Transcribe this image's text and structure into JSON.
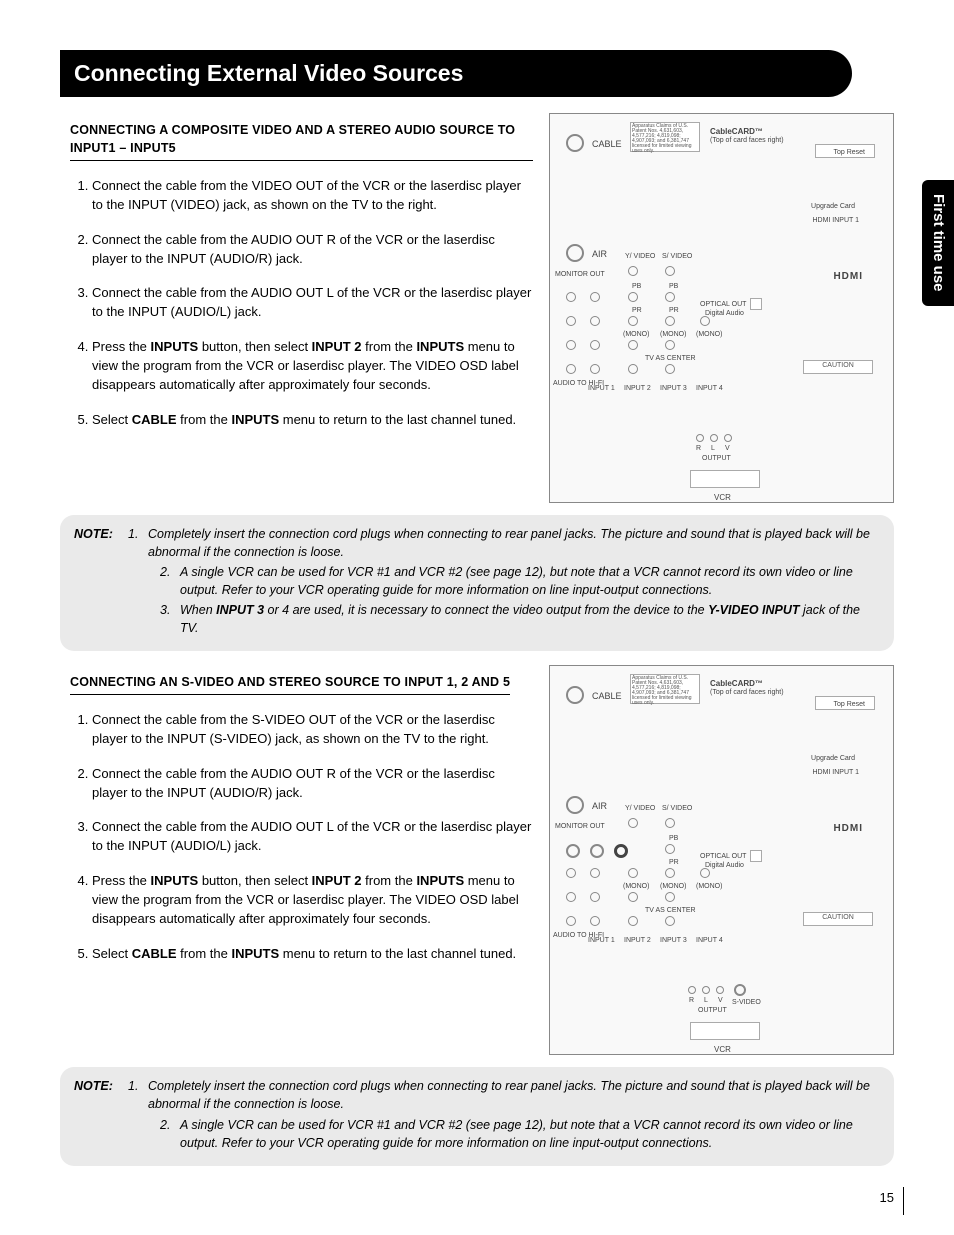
{
  "page_number": "15",
  "side_tab": "First time use",
  "header": "Connecting External Video Sources",
  "section1": {
    "title": "CONNECTING A COMPOSITE VIDEO AND A STEREO AUDIO SOURCE TO INPUT1 – INPUT5",
    "steps": {
      "s1": "Connect the cable from the VIDEO OUT of the VCR or the laserdisc player to the INPUT (VIDEO) jack, as shown on the TV to the right.",
      "s2": "Connect the cable from the AUDIO OUT R of the VCR or the laserdisc player to the INPUT (AUDIO/R) jack.",
      "s3": "Connect the cable from the AUDIO OUT L of the VCR or the laserdisc player to the INPUT (AUDIO/L) jack.",
      "s4_a": "Press the ",
      "s4_inputs1": "INPUTS",
      "s4_b": " button, then select ",
      "s4_input2": "INPUT 2",
      "s4_c": " from the ",
      "s4_inputs2": "INPUTS",
      "s4_d": " menu to view the program from the VCR or laserdisc player. The VIDEO OSD label disappears automatically after approximately four seconds.",
      "s5_a": "Select ",
      "s5_cable": "CABLE",
      "s5_b": " from the ",
      "s5_inputs": "INPUTS",
      "s5_c": " menu to return to the last channel tuned."
    }
  },
  "note1": {
    "label": "NOTE:",
    "n1": "Completely insert the connection cord plugs when connecting to rear panel jacks. The picture and sound that is played back will be abnormal if the connection is loose.",
    "n2": "A single VCR can be used for VCR #1 and VCR #2 (see page 12), but note that a VCR cannot record its own video or line output. Refer to your VCR operating guide for more information on line input-output connections.",
    "n3_a": "When ",
    "n3_b": "INPUT 3",
    "n3_c": " or 4 are used, it is necessary to connect the video output from the device to the ",
    "n3_d": "Y-VIDEO INPUT",
    "n3_e": " jack of the TV."
  },
  "section2": {
    "title": "CONNECTING AN S-VIDEO AND STEREO SOURCE TO INPUT 1, 2 AND 5",
    "steps": {
      "s1": "Connect the cable from the S-VIDEO OUT of the VCR or the laserdisc player to the INPUT (S-VIDEO) jack, as shown on the TV to the right.",
      "s2": "Connect the cable from the AUDIO OUT R of the VCR or the laserdisc player to the INPUT (AUDIO/R) jack.",
      "s3": "Connect the cable from the AUDIO OUT L of the VCR or the laserdisc player to the INPUT (AUDIO/L) jack.",
      "s4_a": "Press the ",
      "s4_inputs1": "INPUTS",
      "s4_b": " button, then select ",
      "s4_input2": "INPUT 2",
      "s4_c": " from the ",
      "s4_inputs2": "INPUTS",
      "s4_d": " menu to view the program from the VCR or laserdisc player. The VIDEO OSD label disappears automatically after approximately four seconds.",
      "s5_a": "Select ",
      "s5_cable": "CABLE",
      "s5_b": " from the ",
      "s5_inputs": "INPUTS",
      "s5_c": " menu to return to the last channel tuned."
    }
  },
  "note2": {
    "label": "NOTE:",
    "n1": "Completely insert the connection cord plugs when connecting to rear panel jacks. The picture and sound that is played back will be abnormal if the connection is loose.",
    "n2": "A single VCR can be used for VCR #1 and VCR #2 (see page 12), but note that a VCR cannot record its own video or line output. Refer to your VCR operating guide for more information on line input-output connections."
  },
  "diagram_labels": {
    "cable": "CABLE",
    "air": "AIR",
    "cablecard": "CableCARD™",
    "cablecard_sub": "(Top of card faces right)",
    "patent": "Apparatus Claims of U.S. Patent Nos. 4,631,603, 4,577,216; 4,819,098; 4,907,093; and 6,381,747 licensed for limited viewing uses only.",
    "hdmi": "HDMI",
    "upgrade": "Upgrade Card",
    "hdmi_in": "HDMI INPUT 1",
    "optical": "OPTICAL OUT",
    "digaudio": "Digital Audio",
    "monitor": "MONITOR OUT",
    "tv_center": "TV AS CENTER",
    "audio_hifi": "AUDIO TO HI-FI",
    "in1": "INPUT 1",
    "in2": "INPUT 2",
    "in3": "INPUT 3",
    "in4": "INPUT 4",
    "yvideo": "Y/ VIDEO",
    "svideo_label": "S/ VIDEO",
    "pb": "PB",
    "pr": "PR",
    "mono": "(MONO)",
    "caution": "CAUTION",
    "output": "OUTPUT",
    "r": "R",
    "l": "L",
    "v": "V",
    "svideo": "S-VIDEO",
    "vcr": "VCR",
    "top_reset": "Top Reset"
  }
}
